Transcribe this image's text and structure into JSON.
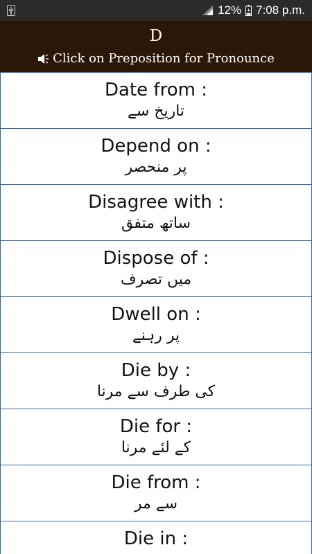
{
  "status_bar": {
    "battery_percent": "12%",
    "time": "7:08 p.m.",
    "icons": [
      "usb-icon",
      "signal-icon",
      "battery-icon"
    ]
  },
  "header": {
    "title": "D",
    "subtitle": "Click on Preposition for Pronounce",
    "icon": "speaker-icon",
    "background": "#2b1708"
  },
  "list": {
    "border_color": "#2a62a8",
    "items": [
      {
        "en": "Date from :",
        "ur": "تاریخ سے"
      },
      {
        "en": "Depend on :",
        "ur": "پر منحصر"
      },
      {
        "en": "Disagree with :",
        "ur": "ساتھ متفق"
      },
      {
        "en": "Dispose of :",
        "ur": "میں تصرف"
      },
      {
        "en": "Dwell on :",
        "ur": "پر رہنے"
      },
      {
        "en": "Die by :",
        "ur": "کی طرف سے مرنا"
      },
      {
        "en": "Die for :",
        "ur": "کے لئے مرنا"
      },
      {
        "en": "Die from :",
        "ur": "سے مر"
      },
      {
        "en": "Die in :",
        "ur": ""
      }
    ]
  }
}
